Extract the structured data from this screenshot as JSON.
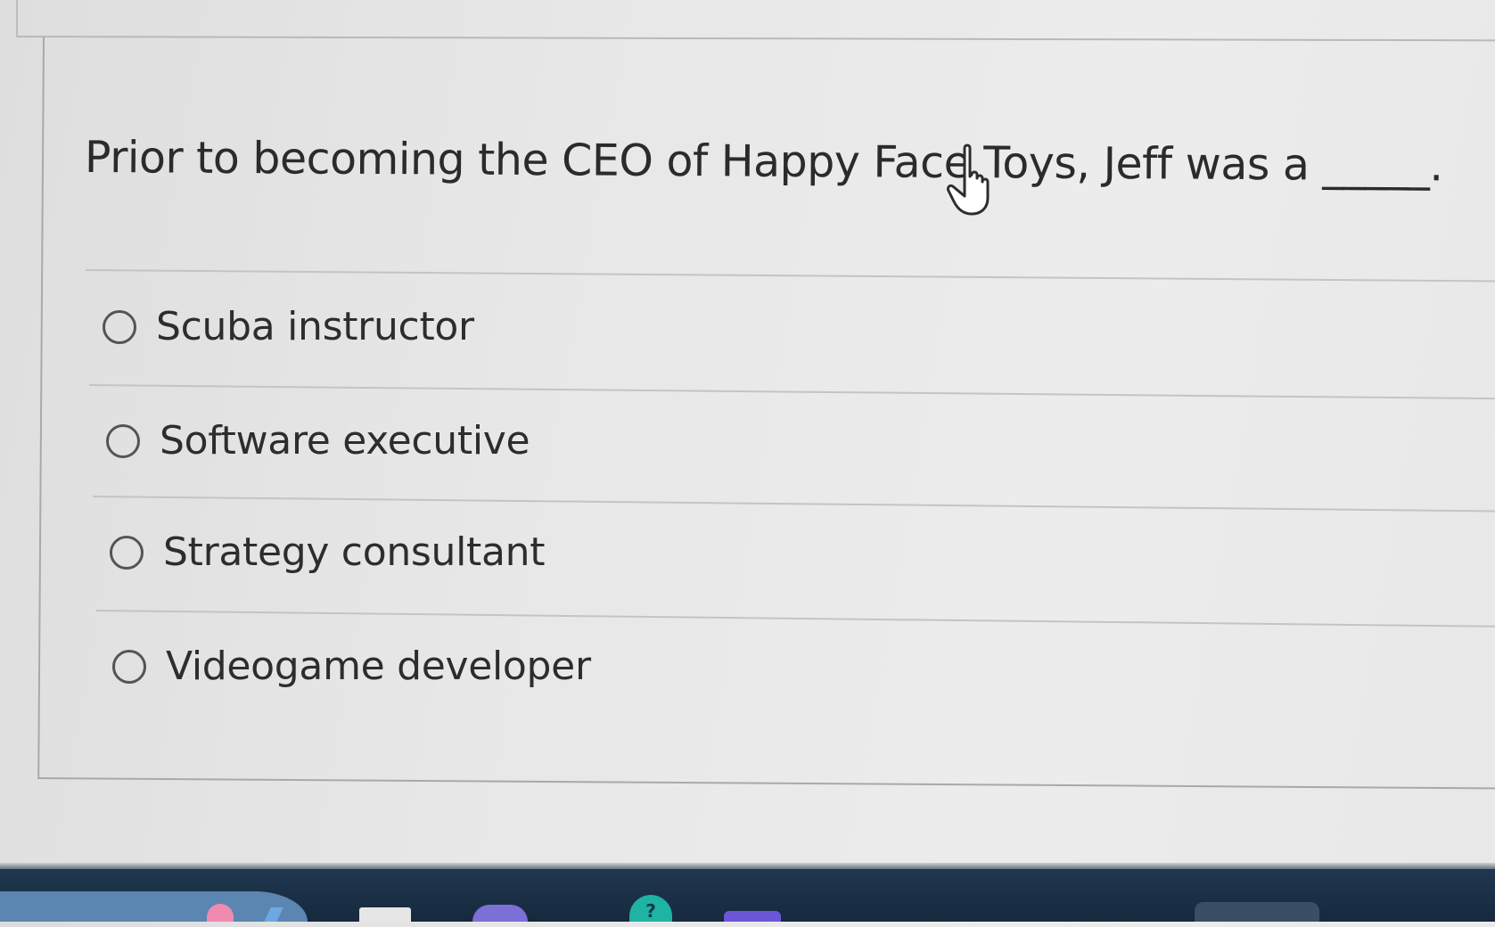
{
  "quiz": {
    "question": "Prior to becoming the CEO of Happy Face Toys, Jeff was a _____.",
    "options": [
      {
        "label": "Scuba instructor",
        "selected": false
      },
      {
        "label": "Software executive",
        "selected": false
      },
      {
        "label": "Strategy consultant",
        "selected": false
      },
      {
        "label": "Videogame developer",
        "selected": false
      }
    ]
  },
  "cursor": {
    "icon": "hand-pointer-icon"
  },
  "taskbar": {
    "icons": [
      "app-icon-pink",
      "app-icon-blue",
      "window-icon",
      "app-icon-purple",
      "help-icon",
      "app-icon-violet",
      "app-icon-grey"
    ],
    "help_label": "?"
  },
  "colors": {
    "background": "#e8e8e8",
    "text": "#2d2d2d",
    "radio_border": "#545454",
    "taskbar": "#1f3750",
    "help_badge": "#1fb3a4"
  }
}
